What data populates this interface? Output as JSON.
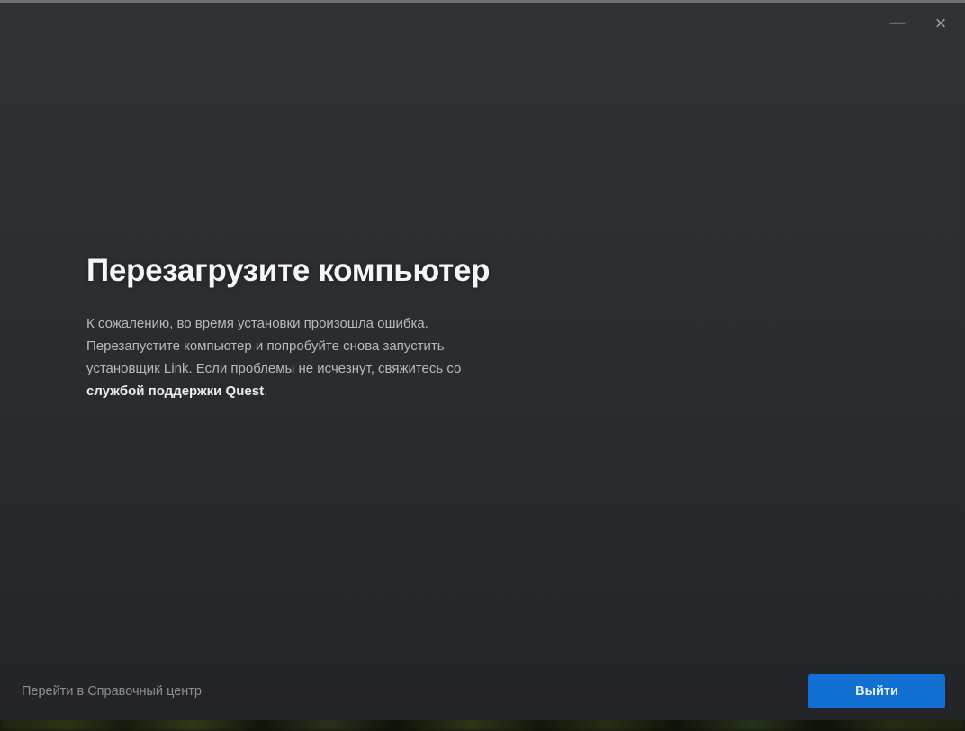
{
  "window": {
    "titlebar": {
      "minimize_icon": "—",
      "close_icon": "×"
    },
    "content": {
      "title": "Перезагрузите компьютер",
      "body_lines": {
        "0": "К сожалению, во время установки произошла ошибка.",
        "1": "Перезапустите компьютер и попробуйте снова запустить",
        "2": "установщик Link. Если проблемы не исчезнут, свяжитесь со"
      },
      "support_link": "службой поддержки Quest",
      "support_suffix": "."
    },
    "footer": {
      "help_link": "Перейти в Справочный центр",
      "exit_button": "Выйти"
    },
    "colors": {
      "accent_blue": "#1170d2",
      "background_top": "#303236",
      "background_bottom": "#232427",
      "title_text": "#f5f6f6",
      "body_text": "#b8babd",
      "footer_link": "#8d9093",
      "titlebar_icons": "#9a9da0",
      "top_border": "#6d7073",
      "wallpaper_green": "#27331a"
    }
  }
}
